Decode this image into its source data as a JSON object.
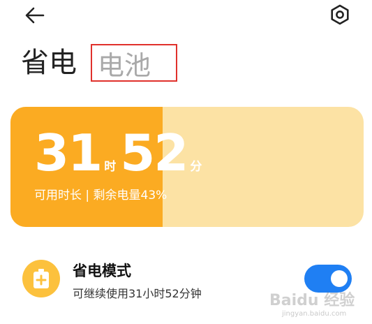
{
  "header": {
    "back_icon": "arrow-left-icon",
    "settings_icon": "gear-icon"
  },
  "tabs": [
    {
      "label": "省电",
      "active": true
    },
    {
      "label": "电池",
      "active": false,
      "highlight_color": "#e0312c"
    }
  ],
  "battery": {
    "hours": "31",
    "hours_unit": "时",
    "minutes": "52",
    "minutes_unit": "分",
    "info": "可用时长 | 剩余电量43%",
    "level_percent": 43,
    "fill_color": "#fbab22",
    "track_color": "#fce2a4"
  },
  "power_saving": {
    "title": "省电模式",
    "subtitle": "可继续使用31小时52分钟",
    "icon": "battery-plus-icon",
    "enabled": true,
    "toggle_color": "#1f7ff3"
  },
  "watermark": {
    "text": "Baidu 经验",
    "sub": "jingyan.baidu.com"
  }
}
